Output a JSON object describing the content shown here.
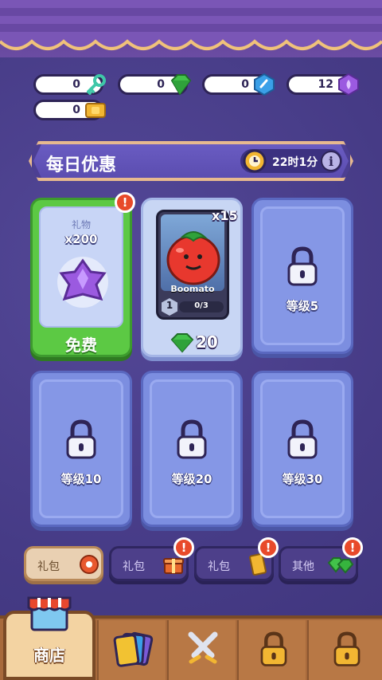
{
  "resources": [
    {
      "name": "key",
      "value": "0",
      "icon": "key-icon",
      "color": "#3fc7a8"
    },
    {
      "name": "gem",
      "value": "0",
      "icon": "green-gem-icon",
      "color": "#42c24a"
    },
    {
      "name": "crystal",
      "value": "0",
      "icon": "blue-crystal-icon",
      "color": "#3aa0e8"
    },
    {
      "name": "purple",
      "value": "12",
      "icon": "purple-crystal-icon",
      "color": "#9b5ae0"
    },
    {
      "name": "ticket",
      "value": "0",
      "icon": "gold-ticket-icon",
      "color": "#f2b632"
    }
  ],
  "daily": {
    "title": "每日优惠",
    "timer": "22时1分",
    "clock_icon": "clock-icon",
    "info_icon": "info-icon"
  },
  "cards": {
    "free": {
      "top_label": "礼物",
      "amount": "x200",
      "button": "免费",
      "alert": "!"
    },
    "deal": {
      "qty": "x15",
      "name": "Boomato",
      "level": "1",
      "progress": "0/3",
      "price": "20"
    },
    "locked": [
      {
        "label": "等级5"
      },
      {
        "label": "等级10"
      },
      {
        "label": "等级20"
      },
      {
        "label": "等级30"
      }
    ]
  },
  "categories": [
    {
      "label": "礼包",
      "active": true,
      "alert": false
    },
    {
      "label": "礼包",
      "active": false,
      "alert": true
    },
    {
      "label": "礼包",
      "active": false,
      "alert": true
    },
    {
      "label": "其他",
      "active": false,
      "alert": true
    }
  ],
  "nav": {
    "shop_label": "商店",
    "alert": "!"
  },
  "colors": {
    "background": "#4a3f8c",
    "free_card": "#5cc944",
    "locked_card": "#7c8ee0",
    "alert": "#e84a2a",
    "nav": "#a86a3c"
  }
}
